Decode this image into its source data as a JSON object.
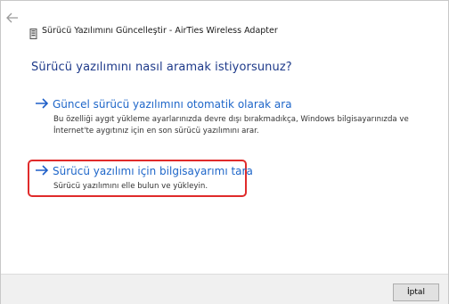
{
  "window": {
    "title": "Sürücü Yazılımını Güncelleştir - AirTies Wireless Adapter",
    "back_icon": "back-arrow-icon",
    "device_icon": "network-adapter-icon"
  },
  "main": {
    "heading": "Sürücü yazılımını nasıl aramak istiyorsunuz?",
    "options": [
      {
        "arrow": "→",
        "title": "Güncel sürücü yazılımını otomatik olarak ara",
        "description": "Bu özelliği aygıt yükleme ayarlarınızda devre dışı bırakmadıkça, Windows bilgisayarınızda ve İnternet'te aygıtınız için en son sürücü yazılımını arar."
      },
      {
        "arrow": "→",
        "title": "Sürücü yazılımı için bilgisayarımı tara",
        "description": "Sürücü yazılımını elle bulun ve yükleyin.",
        "highlighted": true
      }
    ]
  },
  "footer": {
    "cancel_label": "İptal"
  },
  "colors": {
    "heading": "#1e3a8a",
    "link": "#1e66c9",
    "highlight_border": "#e02b2b",
    "footer_bg": "#f0f0f0"
  }
}
